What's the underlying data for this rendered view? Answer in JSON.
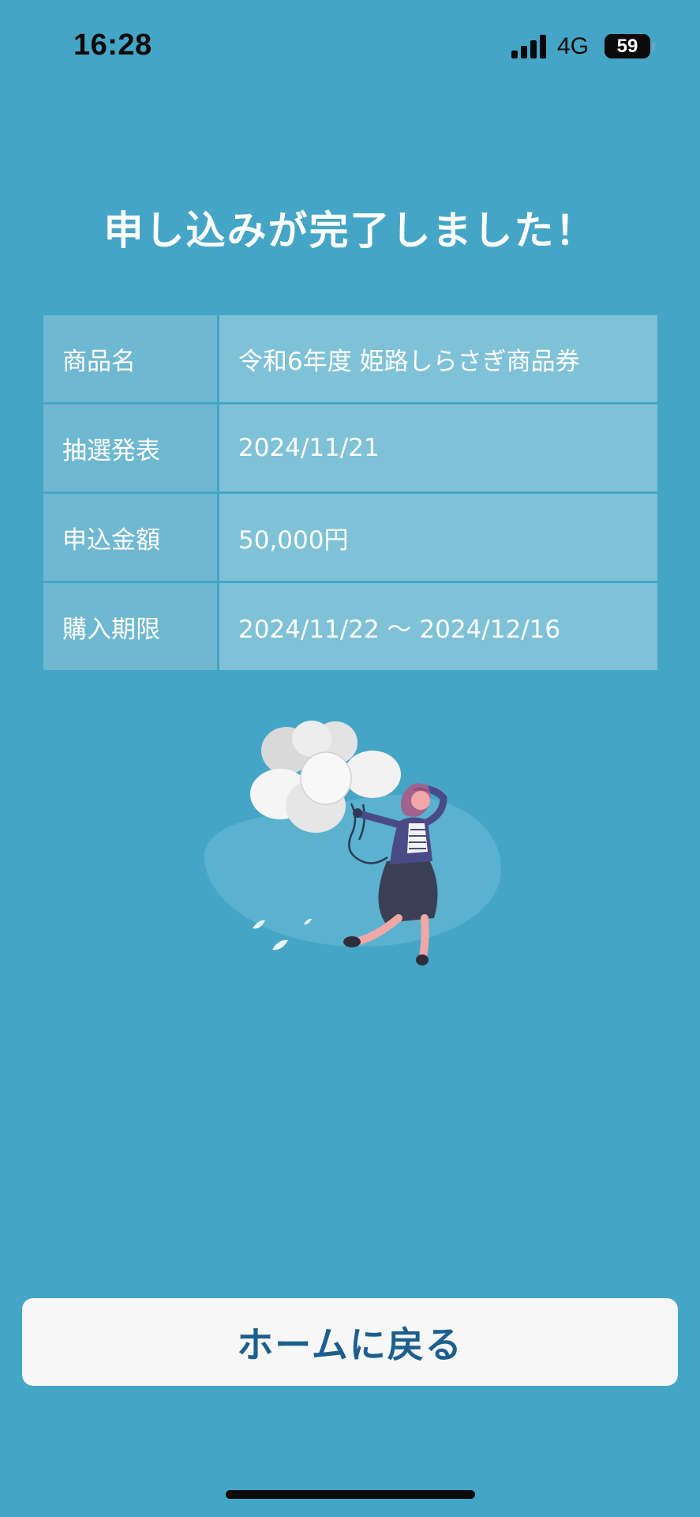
{
  "status_bar": {
    "time": "16:28",
    "network": "4G",
    "battery": "59",
    "signal_icon": "signal-bars-icon"
  },
  "page": {
    "title": "申し込みが完了しました！"
  },
  "details": {
    "rows": [
      {
        "label": "商品名",
        "value": "令和6年度 姫路しらさぎ商品券"
      },
      {
        "label": "抽選発表",
        "value": "2024/11/21"
      },
      {
        "label": "申込金額",
        "value": "50,000円"
      },
      {
        "label": "購入期限",
        "value": "2024/11/22 〜 2024/12/16"
      }
    ]
  },
  "actions": {
    "home_label": "ホームに戻る"
  },
  "colors": {
    "background": "#45a5c6",
    "label_cell": "#6fb8d2",
    "value_cell": "#7fc2d8",
    "button_text": "#1c5f8f"
  },
  "illustration": {
    "icon": "woman-with-balloons-illustration"
  }
}
